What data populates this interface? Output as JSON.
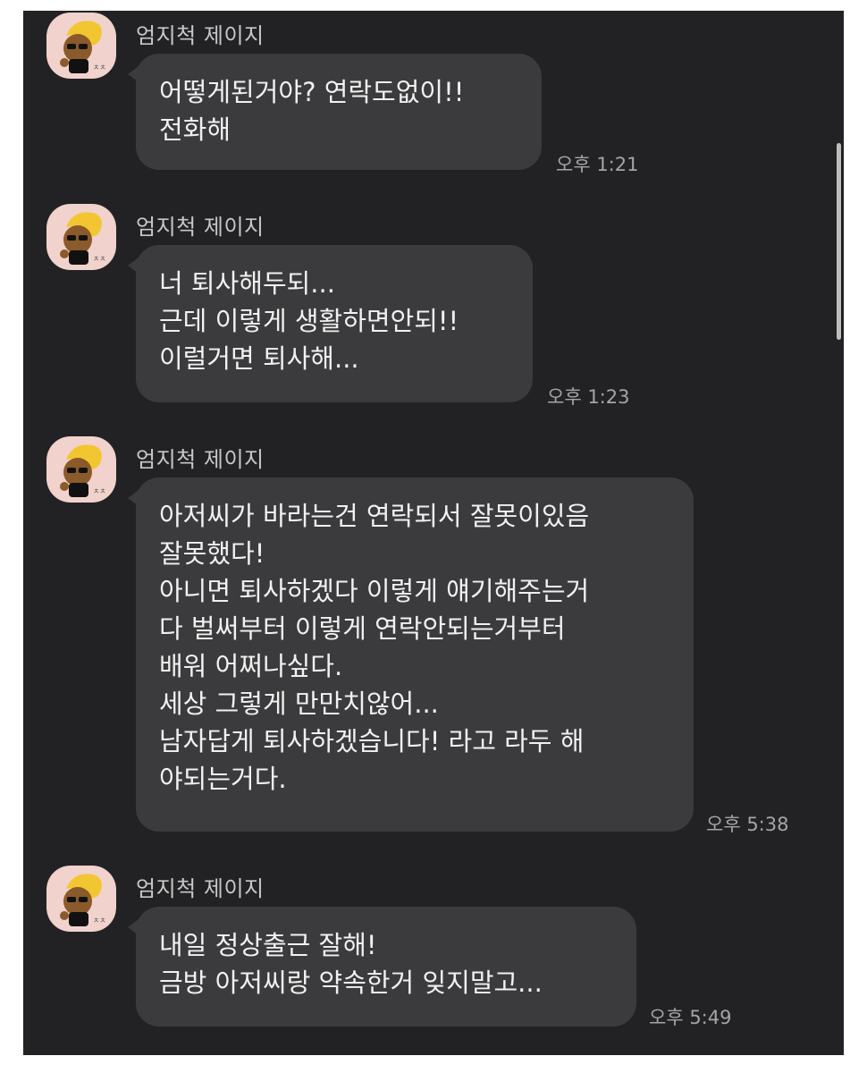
{
  "messages": [
    {
      "sender": "엄지척 제이지",
      "lines": [
        "어떻게된거야? 연락도없이!!",
        "전화해"
      ],
      "time": "오후 1:21"
    },
    {
      "sender": "엄지척 제이지",
      "lines": [
        "너 퇴사해두되...",
        "근데 이렇게 생활하면안되!!",
        "이럴거면 퇴사해..."
      ],
      "time": "오후 1:23"
    },
    {
      "sender": "엄지척 제이지",
      "lines": [
        "아저씨가 바라는건 연락되서 잘못이있음",
        "잘못했다!",
        "아니면 퇴사하겠다 이렇게 얘기해주는거",
        "다 벌써부터 이렇게 연락안되는거부터",
        "배워 어쩌나싶다.",
        "세상 그렇게 만만치않어...",
        "남자답게 퇴사하겠습니다! 라고 라두 해",
        "야되는거다."
      ],
      "time": "오후 5:38"
    },
    {
      "sender": "엄지척 제이지",
      "lines": [
        "내일 정상출근 잘해!",
        "금방 아저씨랑 약속한거 잊지말고..."
      ],
      "time": "오후 5:49"
    }
  ],
  "avatar_icon": "ryan-sunglasses-avatar-icon",
  "colors": {
    "background": "#222224",
    "bubble": "#3b3b3d",
    "text": "#f1f1f1",
    "sender": "#c8c8c8",
    "time": "#a5a5a5",
    "avatar_bg": "#f1d2cc"
  }
}
